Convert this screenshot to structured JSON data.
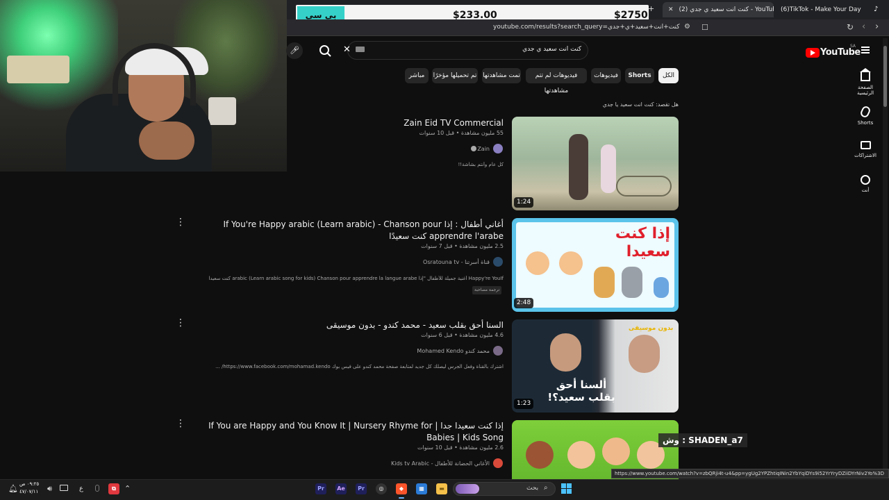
{
  "overlay": {
    "price_label": "بي سي جديد",
    "price_mid": "$233.00",
    "price_right": "$2750"
  },
  "browser": {
    "tabs": [
      {
        "label": "(2) كنت انت سعيد ي جدي - YouTube"
      },
      {
        "label": "(6)TikTok - Make Your Day"
      }
    ],
    "url": "youtube.com/results?search_query=كنت+انت+سعيد+ي+جدي",
    "status_url": "https://www.youtube.com/watch?v=zbQRji4t-u4&pp=ygUg2YPZhtiqINin2YbYqiDYs9i52YrYryDZiiDYrNiv2Yo%3D"
  },
  "youtube": {
    "logo": "YouTube",
    "region": "SA",
    "search_value": "كنت انت سعيد ي جدي",
    "chips": [
      "الكل",
      "Shorts",
      "فيديوهات",
      "فيديوهات لم تتم مشاهدتها",
      "تمت مشاهدتها",
      "تم تحميلها مؤخرًا",
      "مباشر"
    ],
    "did_you_mean": "هل تقصد: كنت انت سعيد يا جدي",
    "nav": [
      {
        "icon": "home-icon",
        "label": "الصفحة الرئيسية"
      },
      {
        "icon": "shorts-icon",
        "label": "Shorts"
      },
      {
        "icon": "subscriptions-icon",
        "label": "الاشتراكات"
      },
      {
        "icon": "you-icon",
        "label": "أنت"
      }
    ],
    "videos": [
      {
        "title": "Zain Eid TV Commercial",
        "meta": "55 مليون مشاهدة • قبل 10 سنوات",
        "channel": "Zain",
        "description": "كل عام وأنتم بشاشة!!",
        "duration": "1:24"
      },
      {
        "title": "أغاني أطفال : إذا If You're Happy arabic (Learn arabic) - Chanson pour apprendre l'arabe كنت سعيدًا",
        "meta": "2.5 مليون مشاهدة • قبل 7 سنوات",
        "channel": "Osratouna tv - قناة أسرتنا",
        "description": "Happy're YouIf أغنية جميلة للأطفال \"إذا arabic (Learn arabic song for kids) Chanson pour apprendre la langue arabe كنت سعيدا\" ...",
        "badge": "ترجمة مصاحبة",
        "duration": "2:48",
        "thumb_text": "إذا كنت سعيدا"
      },
      {
        "title": "السنا أحق بقلب سعيد - محمد كندو - بدون موسيقى",
        "meta": "4.6 مليون مشاهدة • قبل 6 سنوات",
        "channel": "Mohamed Kendo محمد كندو",
        "description": "اشترك بالقناة وفعل الجرس ليصلك كل جديد لمتابعة صفحة محمد كندو على فيس بوك https://www.facebook.com/mohamad.kendo/ ...",
        "duration": "1:23",
        "thumb_tag": "بدون موسيقى",
        "thumb_text": "ألسنا أحق بقلب سعيد؟!"
      },
      {
        "title": "إذا كنت سعيدا جدا | If You are Happy and You Know It | Nursery Rhyme for Babies | Kids Song",
        "meta": "2.6 مليون مشاهدة • قبل 10 سنوات",
        "channel": "Kids tv Arabic - الأغاني الحضانة للأطفال"
      }
    ]
  },
  "chat_overlay": "SHADEN_a7 : وش",
  "taskbar": {
    "search_placeholder": "بحث",
    "time": "٠٩:٢٥ ص",
    "date": "٤٧/٠٧/١١",
    "lang": "ع"
  }
}
